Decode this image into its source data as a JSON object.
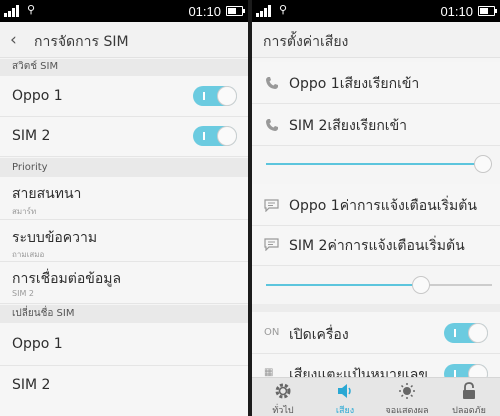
{
  "colors": {
    "accent": "#6bcbe0",
    "accent_active": "#29a8d4"
  },
  "status_bar": {
    "time": "01:10"
  },
  "left": {
    "title": "การจัดการ SIM",
    "section_switch": "สวิตช์ SIM",
    "switch_rows": [
      {
        "label": "Oppo 1",
        "on": true
      },
      {
        "label": "SIM 2",
        "on": true
      }
    ],
    "section_priority": "Priority",
    "priority_rows": [
      {
        "label": "สายสนทนา",
        "sub": "สมาร์ท"
      },
      {
        "label": "ระบบข้อความ",
        "sub": "ถามเสมอ"
      },
      {
        "label": "การเชื่อมต่อข้อมูล",
        "sub": "SIM 2"
      }
    ],
    "section_rename": "เปลี่ยนชื่อ SIM",
    "rename_rows": [
      {
        "label": "Oppo 1"
      },
      {
        "label": "SIM 2"
      }
    ]
  },
  "right": {
    "title": "การตั้งค่าเสียง",
    "ringtone_rows": [
      {
        "label": "Oppo 1เสียงเรียกเข้า",
        "icon": "phone-icon"
      },
      {
        "label": "SIM 2เสียงเรียกเข้า",
        "icon": "phone-icon"
      }
    ],
    "ringtone_volume": 1.0,
    "notify_rows": [
      {
        "label": "Oppo 1ค่าการแจ้งเตือนเริ่มต้น",
        "icon": "message-icon"
      },
      {
        "label": "SIM 2ค่าการแจ้งเตือนเริ่มต้น",
        "icon": "message-icon"
      }
    ],
    "notify_volume": 0.7,
    "boot_row": {
      "prefix": "ON",
      "label": "เปิดเครื่อง",
      "on": true
    },
    "dialpad_row": {
      "label": "เสียงแตะแป้นหมายเลข",
      "on": true
    },
    "nav": [
      {
        "label": "ทั่วไป",
        "icon": "gear-icon",
        "active": false
      },
      {
        "label": "เสียง",
        "icon": "speaker-icon",
        "active": true
      },
      {
        "label": "จอแสดงผล",
        "icon": "brightness-icon",
        "active": false
      },
      {
        "label": "ปลอดภัย",
        "icon": "lock-icon",
        "active": false
      }
    ]
  }
}
